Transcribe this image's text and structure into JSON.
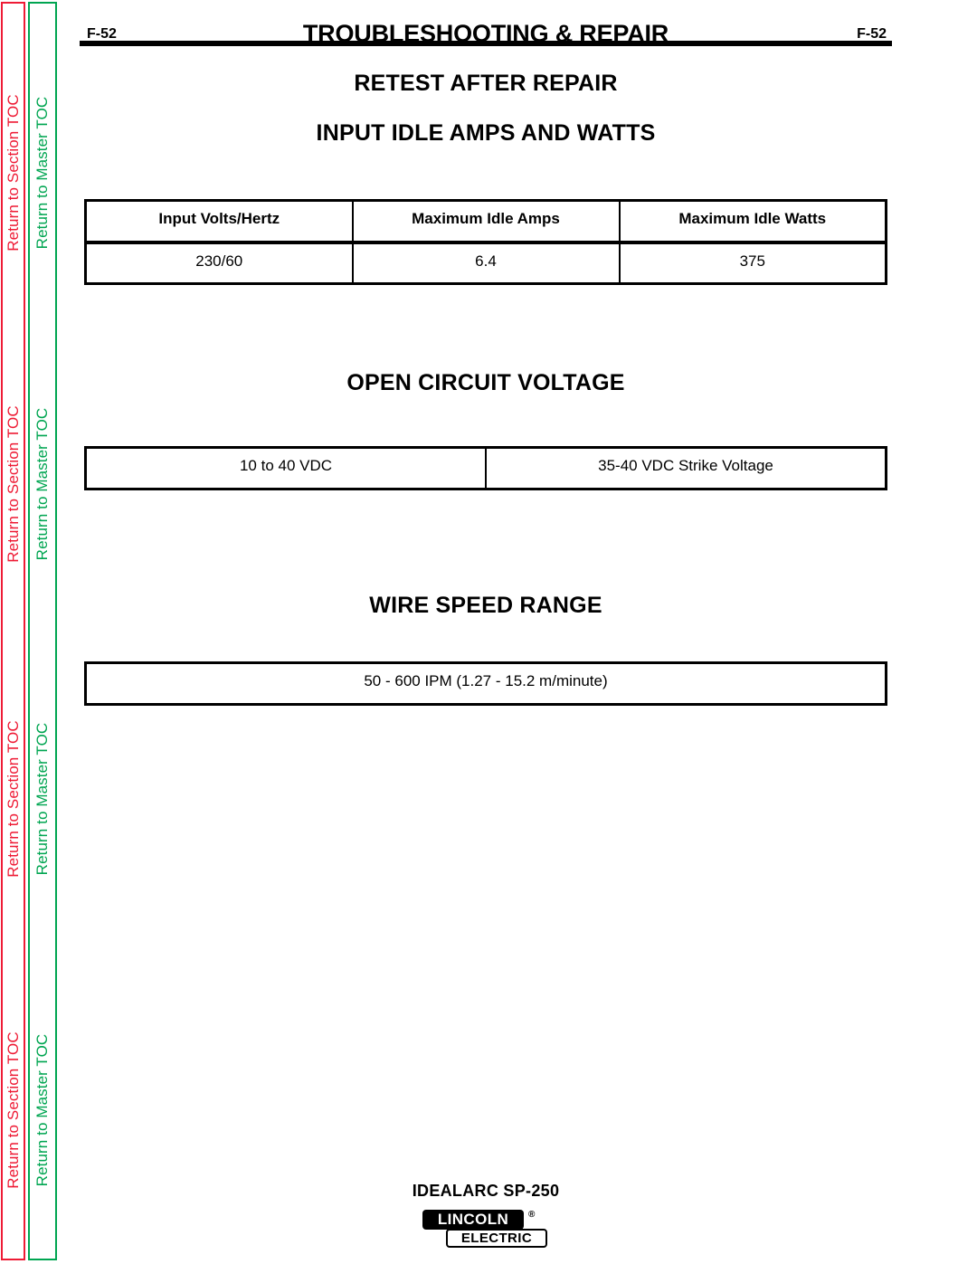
{
  "nav": {
    "section_toc_label": "Return to Section TOC",
    "master_toc_label": "Return to Master TOC",
    "section_color": "#ee1b35",
    "master_color": "#00a551",
    "repeats": 4
  },
  "header": {
    "title": "TROUBLESHOOTING & REPAIR",
    "folio_left": "F-52",
    "folio_right": "F-52"
  },
  "sections": {
    "retest": {
      "heading": "RETEST AFTER REPAIR"
    },
    "input_idle": {
      "heading": "INPUT IDLE AMPS AND WATTS",
      "columns": [
        "Input Volts/Hertz",
        "Maximum Idle Amps",
        "Maximum Idle Watts"
      ],
      "rows": [
        [
          "230/60",
          "6.4",
          "375"
        ]
      ]
    },
    "open_circuit_voltage": {
      "heading": "OPEN CIRCUIT VOLTAGE",
      "rows": [
        [
          "10 to 40 VDC",
          "35-40 VDC Strike Voltage"
        ]
      ]
    },
    "wire_speed_range": {
      "heading": "WIRE SPEED RANGE",
      "rows": [
        [
          "50 - 600 IPM (1.27 - 15.2 m/minute)"
        ]
      ]
    }
  },
  "footer": {
    "model": "IDEALARC SP-250",
    "logo_primary": "LINCOLN",
    "logo_registered": "®",
    "logo_secondary": "ELECTRIC"
  }
}
